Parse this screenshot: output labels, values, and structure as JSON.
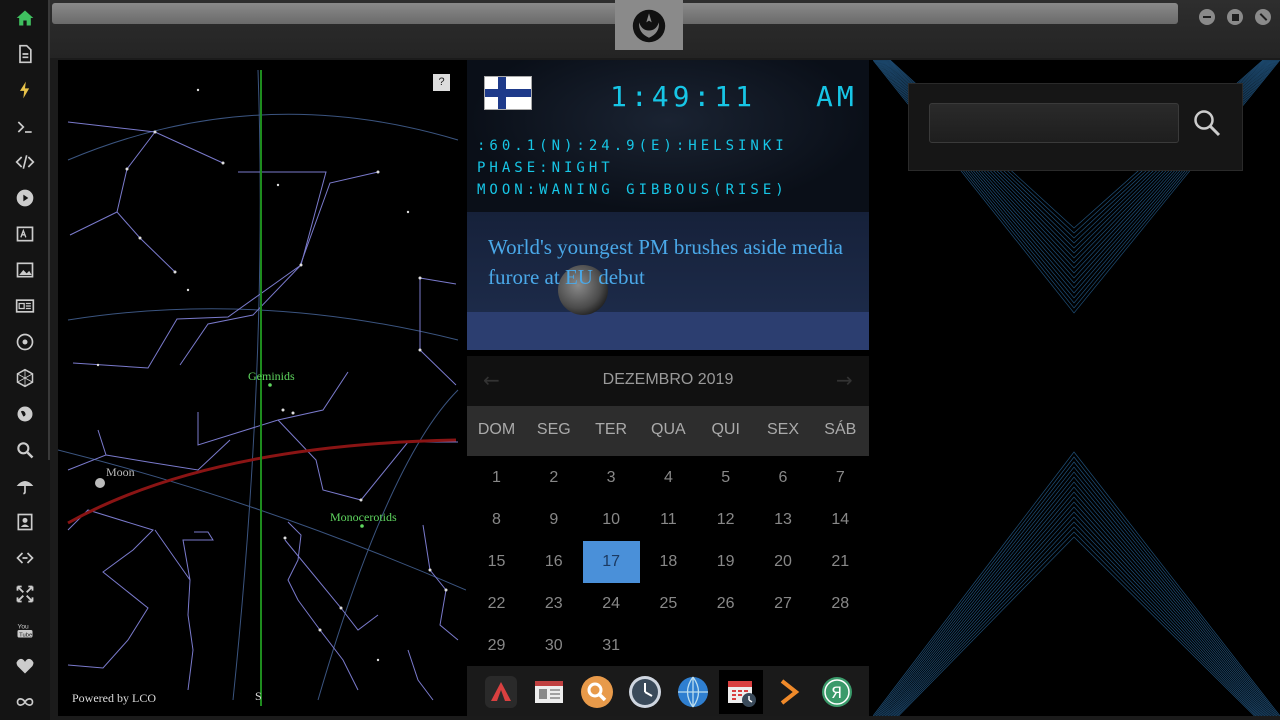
{
  "sidebar": {
    "items": [
      {
        "name": "home-icon",
        "color": "#3fbf5f"
      },
      {
        "name": "document-icon",
        "color": "#cccccc"
      },
      {
        "name": "lightning-icon",
        "color": "#e8c34a"
      },
      {
        "name": "terminal-icon",
        "color": "#cccccc"
      },
      {
        "name": "code-icon",
        "color": "#cccccc"
      },
      {
        "name": "play-icon",
        "color": "#cccccc"
      },
      {
        "name": "translate-icon",
        "color": "#cccccc"
      },
      {
        "name": "image-icon",
        "color": "#cccccc"
      },
      {
        "name": "newspaper-icon",
        "color": "#cccccc"
      },
      {
        "name": "rebel-alliance-icon",
        "color": "#cccccc"
      },
      {
        "name": "hexagon-icon",
        "color": "#cccccc"
      },
      {
        "name": "globe-icon",
        "color": "#cccccc"
      },
      {
        "name": "search-icon",
        "color": "#cccccc"
      },
      {
        "name": "umbrella-icon",
        "color": "#cccccc"
      },
      {
        "name": "contact-card-icon",
        "color": "#cccccc"
      },
      {
        "name": "link-icon",
        "color": "#cccccc"
      },
      {
        "name": "expand-icon",
        "color": "#cccccc"
      },
      {
        "name": "youtube-icon",
        "color": "#cccccc"
      },
      {
        "name": "heart-icon",
        "color": "#cccccc"
      },
      {
        "name": "infinity-icon",
        "color": "#cccccc"
      }
    ]
  },
  "sky": {
    "help_label": "?",
    "labels": {
      "geminids": "Geminids",
      "moon": "Moon",
      "monocerotids": "Monocerotids",
      "south": "S"
    },
    "powered": "Powered by LCO"
  },
  "clock": {
    "time": "1:49:11",
    "ampm": "AM",
    "location": ":60.1(N):24.9(E):HELSINKI",
    "phase": "PHASE:NIGHT",
    "moon": "MOON:WANING GIBBOUS(RISE)"
  },
  "news": {
    "headline": "World's youngest PM brushes aside media furore at EU debut"
  },
  "calendar": {
    "title": "DEZEMBRO 2019",
    "prev": "←",
    "next": "→",
    "weekdays": [
      "DOM",
      "SEG",
      "TER",
      "QUA",
      "QUI",
      "SEX",
      "SÁB"
    ],
    "days": [
      "1",
      "2",
      "3",
      "4",
      "5",
      "6",
      "7",
      "8",
      "9",
      "10",
      "11",
      "12",
      "13",
      "14",
      "15",
      "16",
      "17",
      "18",
      "19",
      "20",
      "21",
      "22",
      "23",
      "24",
      "25",
      "26",
      "27",
      "28",
      "29",
      "30",
      "31"
    ],
    "selected": "17"
  },
  "dock": {
    "items": [
      "app-launcher-icon",
      "news-reader-icon",
      "search-app-icon",
      "clock-app-icon",
      "browser-globe-icon",
      "calendar-app-icon",
      "terminal-app-icon",
      "yandex-icon"
    ]
  },
  "search": {
    "placeholder": "",
    "value": ""
  },
  "colors": {
    "accent": "#4a90d9",
    "clock": "#17c6e6",
    "news": "#4aa8e8"
  }
}
